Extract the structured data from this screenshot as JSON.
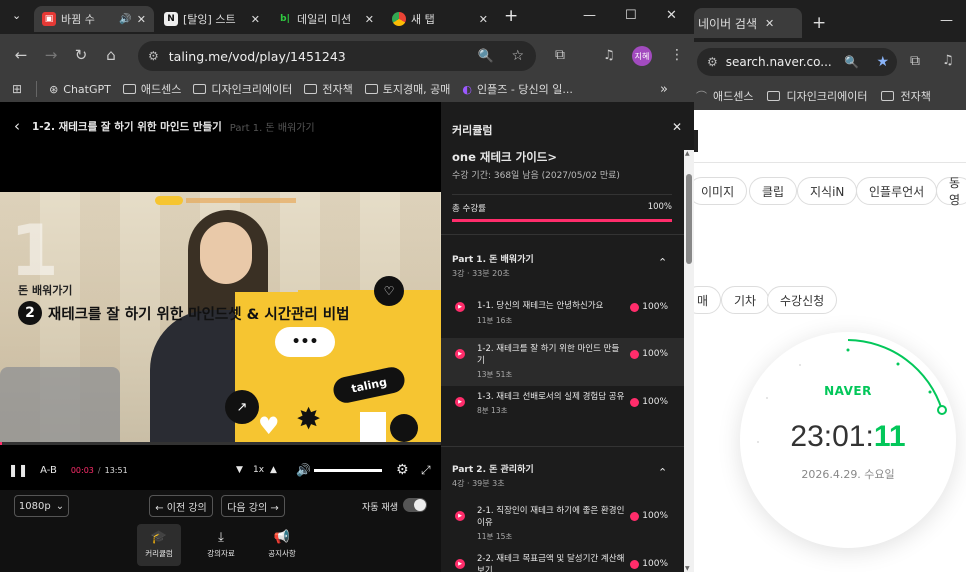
{
  "tabs": [
    {
      "label": "바뀜 수",
      "active": true
    },
    {
      "label": "[탈잉] 스트"
    },
    {
      "label": "데일리 미션"
    },
    {
      "label": "새 탭"
    }
  ],
  "address": {
    "url": "taling.me/vod/play/1451243"
  },
  "profile": {
    "label": "지혜"
  },
  "bookmarks": [
    "ChatGPT",
    "애드센스",
    "디자인크리에이터",
    "전자책",
    "토지경매, 공매",
    "인플즈 - 당신의 일..."
  ],
  "player": {
    "title": "1-2. 재테크를 잘 하기 위한 마인드 만들기",
    "crumb": "Part 1. 돈 배워가기",
    "video_kicker": "돈 배워가기",
    "video_number": "2",
    "video_heading": "재테크를 잘 하기 위한 마인드셋 & 시간관리 비법",
    "video_brand": "taling",
    "ab": "A-B",
    "time_current": "00:03",
    "time_total": "13:51",
    "speed": "1x",
    "progress": 0.004,
    "quality": "1080p",
    "prev_label": "← 이전 강의",
    "next_label": "다음 강의 →",
    "autoplay_label": "자동 재생",
    "nav": [
      "커리큘럼",
      "강의자료",
      "공지사항"
    ]
  },
  "curriculum": {
    "header": "커리큘럼",
    "course_title": "one 재테크 가이드>",
    "period": "수강 기간: 368일 남음 (2027/05/02 만료)",
    "total_label": "총 수강률",
    "total_pct": "100%",
    "parts": [
      {
        "title": "Part 1. 돈 배워가기",
        "meta": "3강 · 33분 20초",
        "lessons": [
          {
            "title": "1-1. 당신의 재테크는 안녕하신가요",
            "time": "11분 16초",
            "pct": "100%"
          },
          {
            "title": "1-2. 재테크를 잘 하기 위한 마인드 만들기",
            "time": "13분 51초",
            "pct": "100%"
          },
          {
            "title": "1-3. 재테크 선배로서의 실제 경험담 공유",
            "time": "8분 13초",
            "pct": "100%"
          }
        ]
      },
      {
        "title": "Part 2. 돈 관리하기",
        "meta": "4강 · 39분 3초",
        "lessons": [
          {
            "title": "2-1. 직장인이 재테크 하기에 좋은 환경인 이유",
            "time": "11분 15초",
            "pct": "100%"
          },
          {
            "title": "2-2. 재테크 목표금액 및 달성기간 계산해보기",
            "time": "",
            "pct": "100%"
          }
        ]
      }
    ]
  },
  "naver": {
    "tab_title": "네이버 검색",
    "url": "search.naver.co...",
    "bookmarks": [
      "애드센스",
      "디자인크리에이터",
      "전자책"
    ],
    "chips": [
      "이미지",
      "클립",
      "지식iN",
      "인플루언서",
      "동영"
    ],
    "chips2": [
      "매",
      "기차",
      "수강신청"
    ],
    "brand": "NAVER",
    "time_hm": "23:01:",
    "time_s": "11",
    "date": "2026.4.29. 수요일"
  }
}
